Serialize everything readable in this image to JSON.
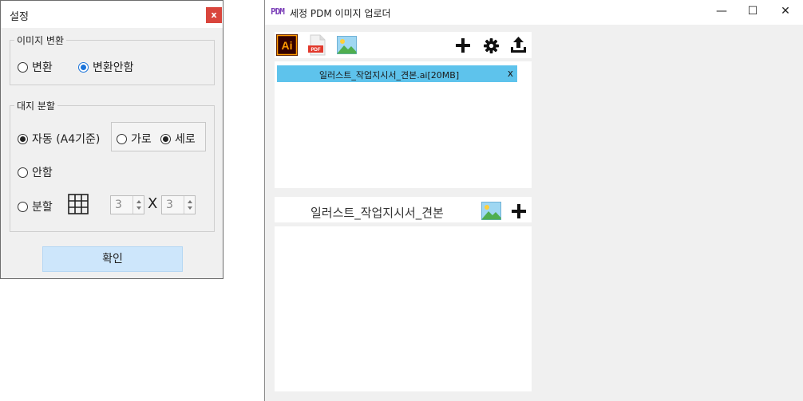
{
  "settings_dialog": {
    "title": "설정",
    "close_label": "x",
    "image_convert": {
      "legend": "이미지 변환",
      "options": [
        {
          "label": "변환",
          "selected": false
        },
        {
          "label": "변환안함",
          "selected": true
        }
      ]
    },
    "split": {
      "legend": "대지 분할",
      "auto_label": "자동 (A4기준)",
      "orientation": [
        {
          "label": "가로",
          "selected": false
        },
        {
          "label": "세로",
          "selected": true
        }
      ],
      "none_label": "안함",
      "manual_label": "분할",
      "rows_value": "3",
      "cols_value": "3",
      "times": "X",
      "selected": "auto"
    },
    "confirm_label": "확인"
  },
  "main_window": {
    "logo_text": "PDM",
    "title": "세정 PDM 이미지 업로더",
    "controls": {
      "minimize": "—",
      "maximize": "☐",
      "close": "✕"
    },
    "toolbar_icons": [
      "illustrator-icon",
      "pdf-icon",
      "image-icon",
      "add-icon",
      "gear-icon",
      "upload-icon"
    ],
    "ai_label": "Ai",
    "pdf_label": "PDF",
    "files": [
      {
        "name": "일러스트_작업지시서_견본.ai[20MB]",
        "remove": "x"
      }
    ],
    "group": {
      "name": "일러스트_작업지시서_견본"
    }
  }
}
